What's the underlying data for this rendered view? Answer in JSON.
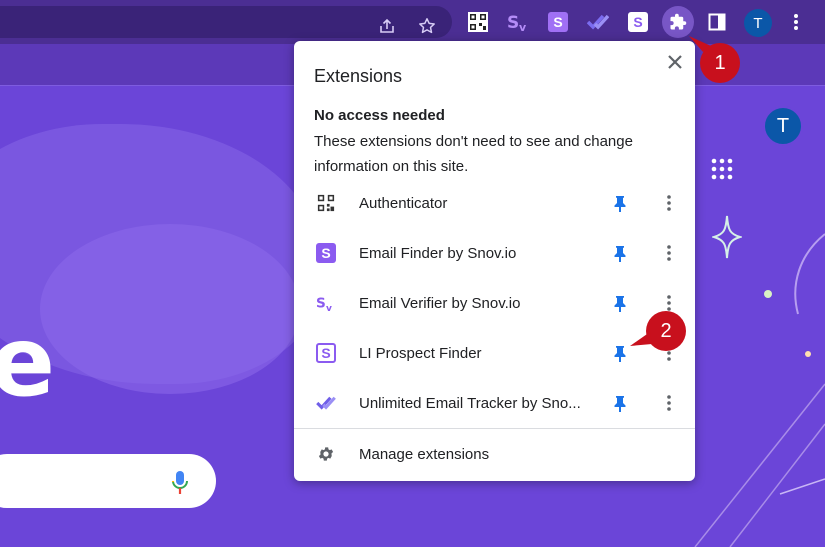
{
  "browser": {
    "profile_initial": "T"
  },
  "page": {
    "logo_letter": "e",
    "profile_initial": "T"
  },
  "callouts": {
    "first": "1",
    "second": "2"
  },
  "extensions_popup": {
    "title": "Extensions",
    "section_heading": "No access needed",
    "section_description": "These extensions don't need to see and change information on this site.",
    "items": [
      {
        "name": "Authenticator",
        "icon": "qr-code-icon"
      },
      {
        "name": "Email Finder by Snov.io",
        "icon": "snov-s-icon"
      },
      {
        "name": "Email Verifier by Snov.io",
        "icon": "snov-sv-icon"
      },
      {
        "name": "LI Prospect Finder",
        "icon": "snov-s-outline-icon"
      },
      {
        "name": "Unlimited Email Tracker by Sno...",
        "icon": "double-check-icon"
      }
    ],
    "manage_label": "Manage extensions"
  },
  "colors": {
    "accent_purple": "#8b5bf0",
    "pin_blue": "#1a73e8",
    "callout_red": "#c8101d",
    "background_purple": "#6b45d8"
  }
}
